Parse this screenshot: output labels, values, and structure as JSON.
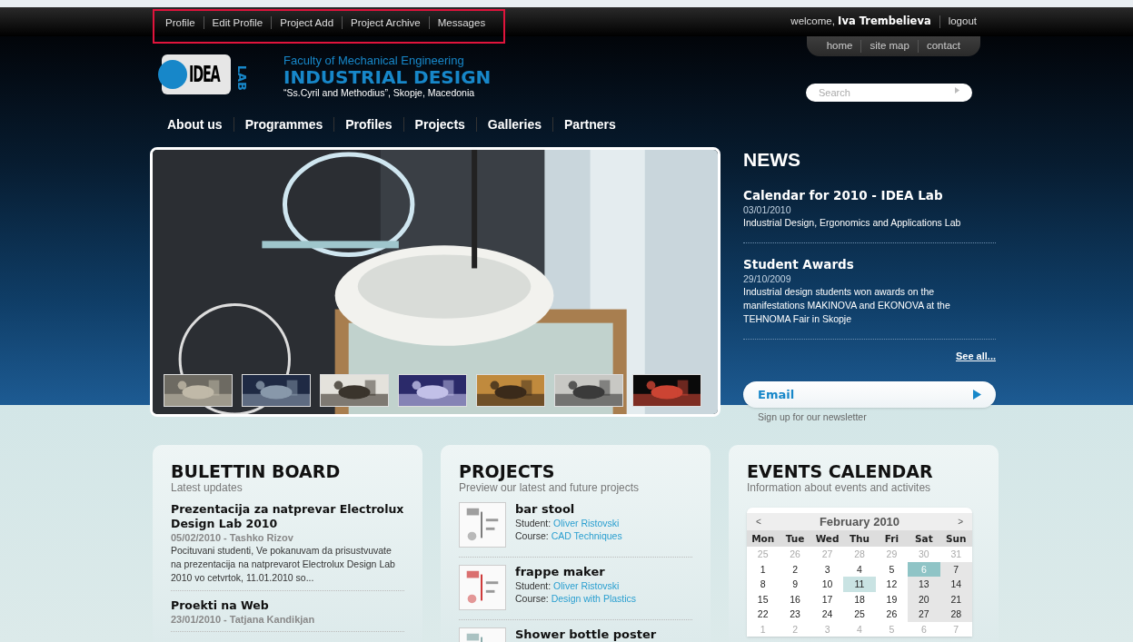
{
  "user_menu": {
    "items": [
      {
        "label": "Profile"
      },
      {
        "label": "Edit Profile"
      },
      {
        "label": "Project Add"
      },
      {
        "label": "Project Archive"
      },
      {
        "label": "Messages"
      }
    ]
  },
  "account": {
    "greeting": "welcome,",
    "user": "Iva Trembelieva",
    "logout": "logout"
  },
  "utility_links": [
    {
      "label": "home"
    },
    {
      "label": "site map"
    },
    {
      "label": "contact"
    }
  ],
  "logo": {
    "word": "IDEA",
    "side": "LAB",
    "faculty": "Faculty of Mechanical Engineering",
    "department": "INDUSTRIAL DESIGN",
    "university": "“Ss.Cyril and Methodius”, Skopje, Macedonia"
  },
  "search": {
    "placeholder": "Search"
  },
  "main_nav": [
    {
      "label": "About us"
    },
    {
      "label": "Programmes"
    },
    {
      "label": "Profiles"
    },
    {
      "label": "Projects"
    },
    {
      "label": "Galleries"
    },
    {
      "label": "Partners"
    }
  ],
  "slideshow": {
    "kind": "picture"
  },
  "news": {
    "title": "NEWS",
    "items": [
      {
        "title": "Calendar for 2010 - IDEA Lab",
        "date": "03/01/2010",
        "summary": "Industrial Design, Ergonomics and Applications Lab"
      },
      {
        "title": "Student Awards",
        "date": "29/10/2009",
        "summary": "Industrial design students won awards on the manifestations MAKINOVA and EKONOVA at the TEHNOMA Fair in Skopje"
      }
    ],
    "see_all": "See all..."
  },
  "newsletter": {
    "placeholder": "Email",
    "note": "Sign up for our newsletter"
  },
  "bulletin": {
    "title": "BULETTIN BOARD",
    "subtitle": "Latest updates",
    "posts": [
      {
        "title": "Prezentacija za natprevar Electrolux Design Lab 2010",
        "meta": "05/02/2010 - Tashko Rizov",
        "excerpt": "Pocituvani studenti, Ve pokanuvam da prisustvuvate na prezentacija na natprevarot Electrolux Design Lab 2010 vo cetvrtok, 11.01.2010 so..."
      },
      {
        "title": "Proekti na Web",
        "meta": "23/01/2010 - Tatjana Kandikjan"
      }
    ]
  },
  "projects": {
    "title": "PROJECTS",
    "subtitle": "Preview our latest and future projects",
    "items": [
      {
        "title": "bar stool",
        "student_label": "Student:",
        "student": "Oliver Ristovski",
        "course_label": "Course:",
        "course": "CAD Techniques"
      },
      {
        "title": "frappe maker",
        "student_label": "Student:",
        "student": "Oliver Ristovski",
        "course_label": "Course:",
        "course": "Design with Plastics"
      },
      {
        "title": "Shower bottle poster"
      }
    ]
  },
  "events": {
    "title": "EVENTS CALENDAR",
    "subtitle": "Information about events and activites",
    "calendar": {
      "prev": "<",
      "month": "February 2010",
      "next": ">",
      "weekdays": [
        "Mon",
        "Tue",
        "Wed",
        "Thu",
        "Fri",
        "Sat",
        "Sun"
      ],
      "days": [
        {
          "label": "25",
          "kind": "other"
        },
        {
          "label": "26",
          "kind": "other"
        },
        {
          "label": "27",
          "kind": "other"
        },
        {
          "label": "28",
          "kind": "other"
        },
        {
          "label": "29",
          "kind": "other"
        },
        {
          "label": "30",
          "kind": "other"
        },
        {
          "label": "31",
          "kind": "other"
        },
        {
          "label": "1",
          "kind": "day"
        },
        {
          "label": "2",
          "kind": "day"
        },
        {
          "label": "3",
          "kind": "day"
        },
        {
          "label": "4",
          "kind": "day"
        },
        {
          "label": "5",
          "kind": "day"
        },
        {
          "label": "6",
          "kind": "today"
        },
        {
          "label": "7",
          "kind": "day"
        },
        {
          "label": "8",
          "kind": "day"
        },
        {
          "label": "9",
          "kind": "day"
        },
        {
          "label": "10",
          "kind": "day"
        },
        {
          "label": "11",
          "kind": "event"
        },
        {
          "label": "12",
          "kind": "day"
        },
        {
          "label": "13",
          "kind": "day"
        },
        {
          "label": "14",
          "kind": "day"
        },
        {
          "label": "15",
          "kind": "day"
        },
        {
          "label": "16",
          "kind": "day"
        },
        {
          "label": "17",
          "kind": "day"
        },
        {
          "label": "18",
          "kind": "day"
        },
        {
          "label": "19",
          "kind": "day"
        },
        {
          "label": "20",
          "kind": "day"
        },
        {
          "label": "21",
          "kind": "day"
        },
        {
          "label": "22",
          "kind": "day"
        },
        {
          "label": "23",
          "kind": "day"
        },
        {
          "label": "24",
          "kind": "day"
        },
        {
          "label": "25",
          "kind": "day"
        },
        {
          "label": "26",
          "kind": "day"
        },
        {
          "label": "27",
          "kind": "day"
        },
        {
          "label": "28",
          "kind": "day"
        },
        {
          "label": "1",
          "kind": "other"
        },
        {
          "label": "2",
          "kind": "other"
        },
        {
          "label": "3",
          "kind": "other"
        },
        {
          "label": "4",
          "kind": "other"
        },
        {
          "label": "5",
          "kind": "other"
        },
        {
          "label": "6",
          "kind": "other"
        },
        {
          "label": "7",
          "kind": "other"
        }
      ]
    }
  }
}
